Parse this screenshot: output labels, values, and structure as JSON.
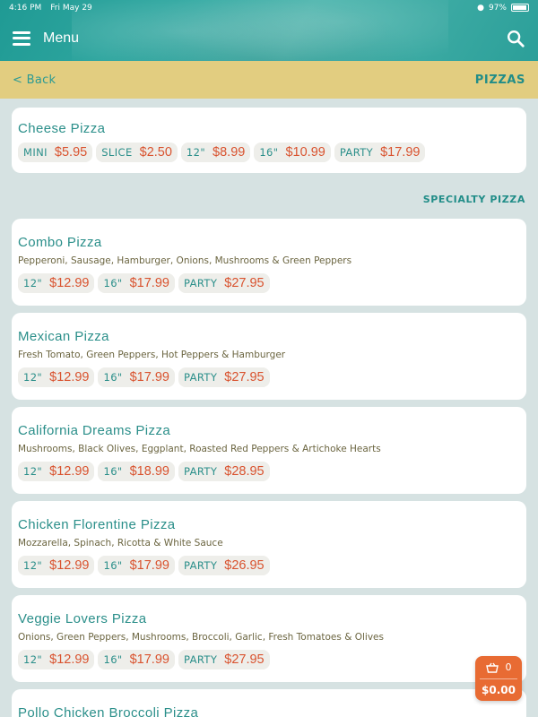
{
  "status": {
    "time": "4:16 PM",
    "date": "Fri May 29",
    "battery": "97%"
  },
  "nav": {
    "title": "Menu"
  },
  "subbar": {
    "back_label": "< Back",
    "section_title": "PIZZAS"
  },
  "cheese": {
    "title": "Cheese Pizza",
    "prices": [
      {
        "size": "MINI",
        "price": "$5.95"
      },
      {
        "size": "SLICE",
        "price": "$2.50"
      },
      {
        "size": "12\"",
        "price": "$8.99"
      },
      {
        "size": "16\"",
        "price": "$10.99"
      },
      {
        "size": "PARTY",
        "price": "$17.99"
      }
    ]
  },
  "specialty_label": "SPECIALTY PIZZA",
  "items": [
    {
      "title": "Combo Pizza",
      "desc": "Pepperoni, Sausage, Hamburger, Onions, Mushrooms & Green Peppers",
      "prices": [
        {
          "size": "12\"",
          "price": "$12.99"
        },
        {
          "size": "16\"",
          "price": "$17.99"
        },
        {
          "size": "PARTY",
          "price": "$27.95"
        }
      ]
    },
    {
      "title": "Mexican Pizza",
      "desc": "Fresh Tomato, Green Peppers, Hot Peppers & Hamburger",
      "prices": [
        {
          "size": "12\"",
          "price": "$12.99"
        },
        {
          "size": "16\"",
          "price": "$17.99"
        },
        {
          "size": "PARTY",
          "price": "$27.95"
        }
      ]
    },
    {
      "title": "California Dreams Pizza",
      "desc": "Mushrooms, Black Olives, Eggplant, Roasted Red Peppers & Artichoke Hearts",
      "prices": [
        {
          "size": "12\"",
          "price": "$12.99"
        },
        {
          "size": "16\"",
          "price": "$18.99"
        },
        {
          "size": "PARTY",
          "price": "$28.95"
        }
      ]
    },
    {
      "title": "Chicken Florentine Pizza",
      "desc": "Mozzarella, Spinach, Ricotta & White Sauce",
      "prices": [
        {
          "size": "12\"",
          "price": "$12.99"
        },
        {
          "size": "16\"",
          "price": "$17.99"
        },
        {
          "size": "PARTY",
          "price": "$26.95"
        }
      ]
    },
    {
      "title": "Veggie Lovers Pizza",
      "desc": "Onions, Green Peppers, Mushrooms, Broccoli, Garlic, Fresh Tomatoes & Olives",
      "prices": [
        {
          "size": "12\"",
          "price": "$12.99"
        },
        {
          "size": "16\"",
          "price": "$17.99"
        },
        {
          "size": "PARTY",
          "price": "$27.95"
        }
      ]
    },
    {
      "title": "Pollo Chicken Broccoli Pizza"
    }
  ],
  "cart": {
    "count": "0",
    "total": "$0.00"
  },
  "colors": {
    "teal": "#2b8f8a",
    "price": "#d9532f",
    "gold_bar": "#e2cd80",
    "cart": "#e86b33"
  }
}
